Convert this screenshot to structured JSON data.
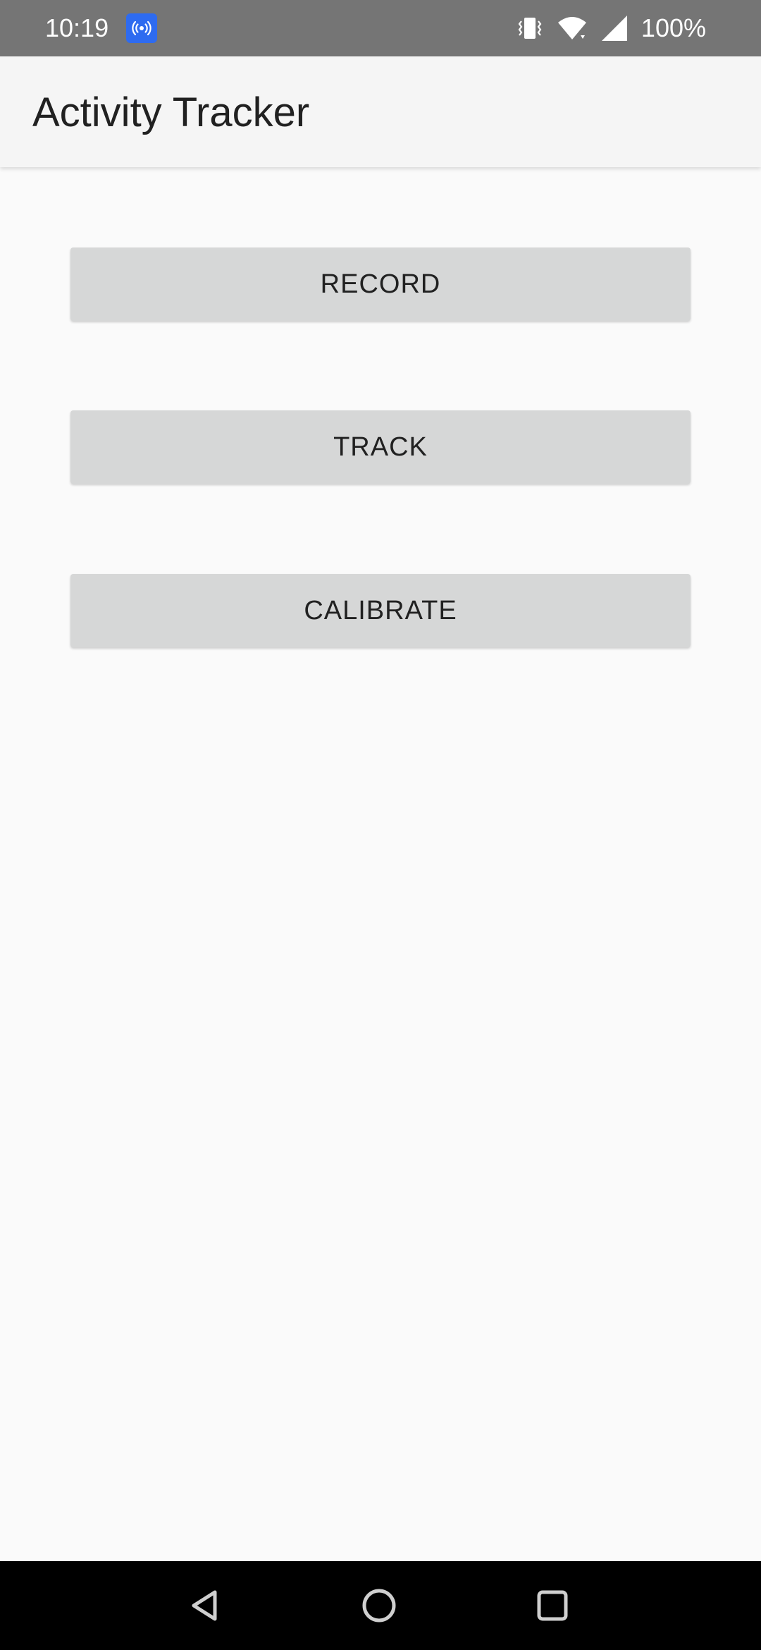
{
  "status_bar": {
    "time": "10:19",
    "battery_percent": "100%",
    "icons": [
      "hotspot-icon",
      "vibrate-icon",
      "wifi-icon",
      "signal-icon"
    ],
    "background": "#757575",
    "badge_color": "#2e6bf0"
  },
  "app_bar": {
    "title": "Activity Tracker"
  },
  "buttons": {
    "record": "RECORD",
    "track": "TRACK",
    "calibrate": "CALIBRATE"
  },
  "nav_bar": {
    "icons": [
      "back-icon",
      "home-icon",
      "recents-icon"
    ]
  }
}
